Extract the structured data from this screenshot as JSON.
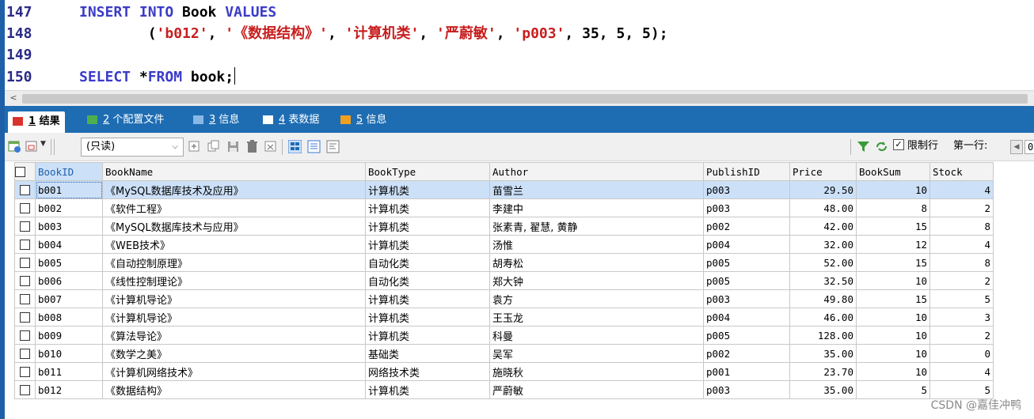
{
  "editor": {
    "lines": [
      {
        "no": "147",
        "parts": [
          {
            "cls": "kw",
            "t": "INSERT INTO "
          },
          {
            "cls": "ident",
            "t": "Book "
          },
          {
            "cls": "kw",
            "t": "VALUES"
          }
        ]
      },
      {
        "no": "148",
        "parts": [
          {
            "cls": "op",
            "t": "        ("
          },
          {
            "cls": "str",
            "t": "'b012'"
          },
          {
            "cls": "op",
            "t": ", "
          },
          {
            "cls": "str",
            "t": "'《数据结构》'"
          },
          {
            "cls": "op",
            "t": ", "
          },
          {
            "cls": "str",
            "t": "'计算机类'"
          },
          {
            "cls": "op",
            "t": ", "
          },
          {
            "cls": "str",
            "t": "'严蔚敏'"
          },
          {
            "cls": "op",
            "t": ", "
          },
          {
            "cls": "str",
            "t": "'p003'"
          },
          {
            "cls": "op",
            "t": ", "
          },
          {
            "cls": "num",
            "t": "35"
          },
          {
            "cls": "op",
            "t": ", "
          },
          {
            "cls": "num",
            "t": "5"
          },
          {
            "cls": "op",
            "t": ", "
          },
          {
            "cls": "num",
            "t": "5"
          },
          {
            "cls": "op",
            "t": ");"
          }
        ]
      },
      {
        "no": "149",
        "parts": []
      },
      {
        "no": "150",
        "parts": [
          {
            "cls": "kw",
            "t": "SELECT "
          },
          {
            "cls": "op",
            "t": "*"
          },
          {
            "cls": "kw",
            "t": "FROM "
          },
          {
            "cls": "ident",
            "t": "book"
          },
          {
            "cls": "op",
            "t": ";"
          }
        ]
      }
    ]
  },
  "tabs": [
    {
      "num": "1",
      "label": " 结果",
      "active": true,
      "color": "#d9342b"
    },
    {
      "num": "2",
      "label": " 个配置文件",
      "active": false,
      "color": "#4caf50"
    },
    {
      "num": "3",
      "label": " 信息",
      "active": false,
      "color": "#8ab8e6"
    },
    {
      "num": "4",
      "label": " 表数据",
      "active": false,
      "color": "#ffffff"
    },
    {
      "num": "5",
      "label": " 信息",
      "active": false,
      "color": "#f0a020"
    }
  ],
  "toolbar": {
    "readonly_label": "(只读)",
    "limit_rows_label": "限制行",
    "first_row_label": "第一行:",
    "first_row_value": "0"
  },
  "grid": {
    "columns": [
      "BookID",
      "BookName",
      "BookType",
      "Author",
      "PublishID",
      "Price",
      "BookSum",
      "Stock"
    ],
    "rows": [
      [
        "b001",
        "《MySQL数据库技术及应用》",
        "计算机类",
        "苗雪兰",
        "p003",
        "29.50",
        "10",
        "4"
      ],
      [
        "b002",
        "《软件工程》",
        "计算机类",
        "李建中",
        "p003",
        "48.00",
        "8",
        "2"
      ],
      [
        "b003",
        "《MySQL数据库技术与应用》",
        "计算机类",
        "张素青, 翟慧, 黄静",
        "p002",
        "42.00",
        "15",
        "8"
      ],
      [
        "b004",
        "《WEB技术》",
        "计算机类",
        "汤惟",
        "p004",
        "32.00",
        "12",
        "4"
      ],
      [
        "b005",
        "《自动控制原理》",
        "自动化类",
        "胡寿松",
        "p005",
        "52.00",
        "15",
        "8"
      ],
      [
        "b006",
        "《线性控制理论》",
        "自动化类",
        "郑大钟",
        "p005",
        "32.50",
        "10",
        "2"
      ],
      [
        "b007",
        "《计算机导论》",
        "计算机类",
        "袁方",
        "p003",
        "49.80",
        "15",
        "5"
      ],
      [
        "b008",
        "《计算机导论》",
        "计算机类",
        "王玉龙",
        "p004",
        "46.00",
        "10",
        "3"
      ],
      [
        "b009",
        "《算法导论》",
        "计算机类",
        "科曼",
        "p005",
        "128.00",
        "10",
        "2"
      ],
      [
        "b010",
        "《数学之美》",
        "基础类",
        "吴军",
        "p002",
        "35.00",
        "10",
        "0"
      ],
      [
        "b011",
        "《计算机网络技术》",
        "网络技术类",
        "施晓秋",
        "p001",
        "23.70",
        "10",
        "4"
      ],
      [
        "b012",
        "《数据结构》",
        "计算机类",
        "严蔚敏",
        "p003",
        "35.00",
        "5",
        "5"
      ]
    ],
    "selected_row": 0
  },
  "watermark": "CSDN @嘉佳冲鸭"
}
